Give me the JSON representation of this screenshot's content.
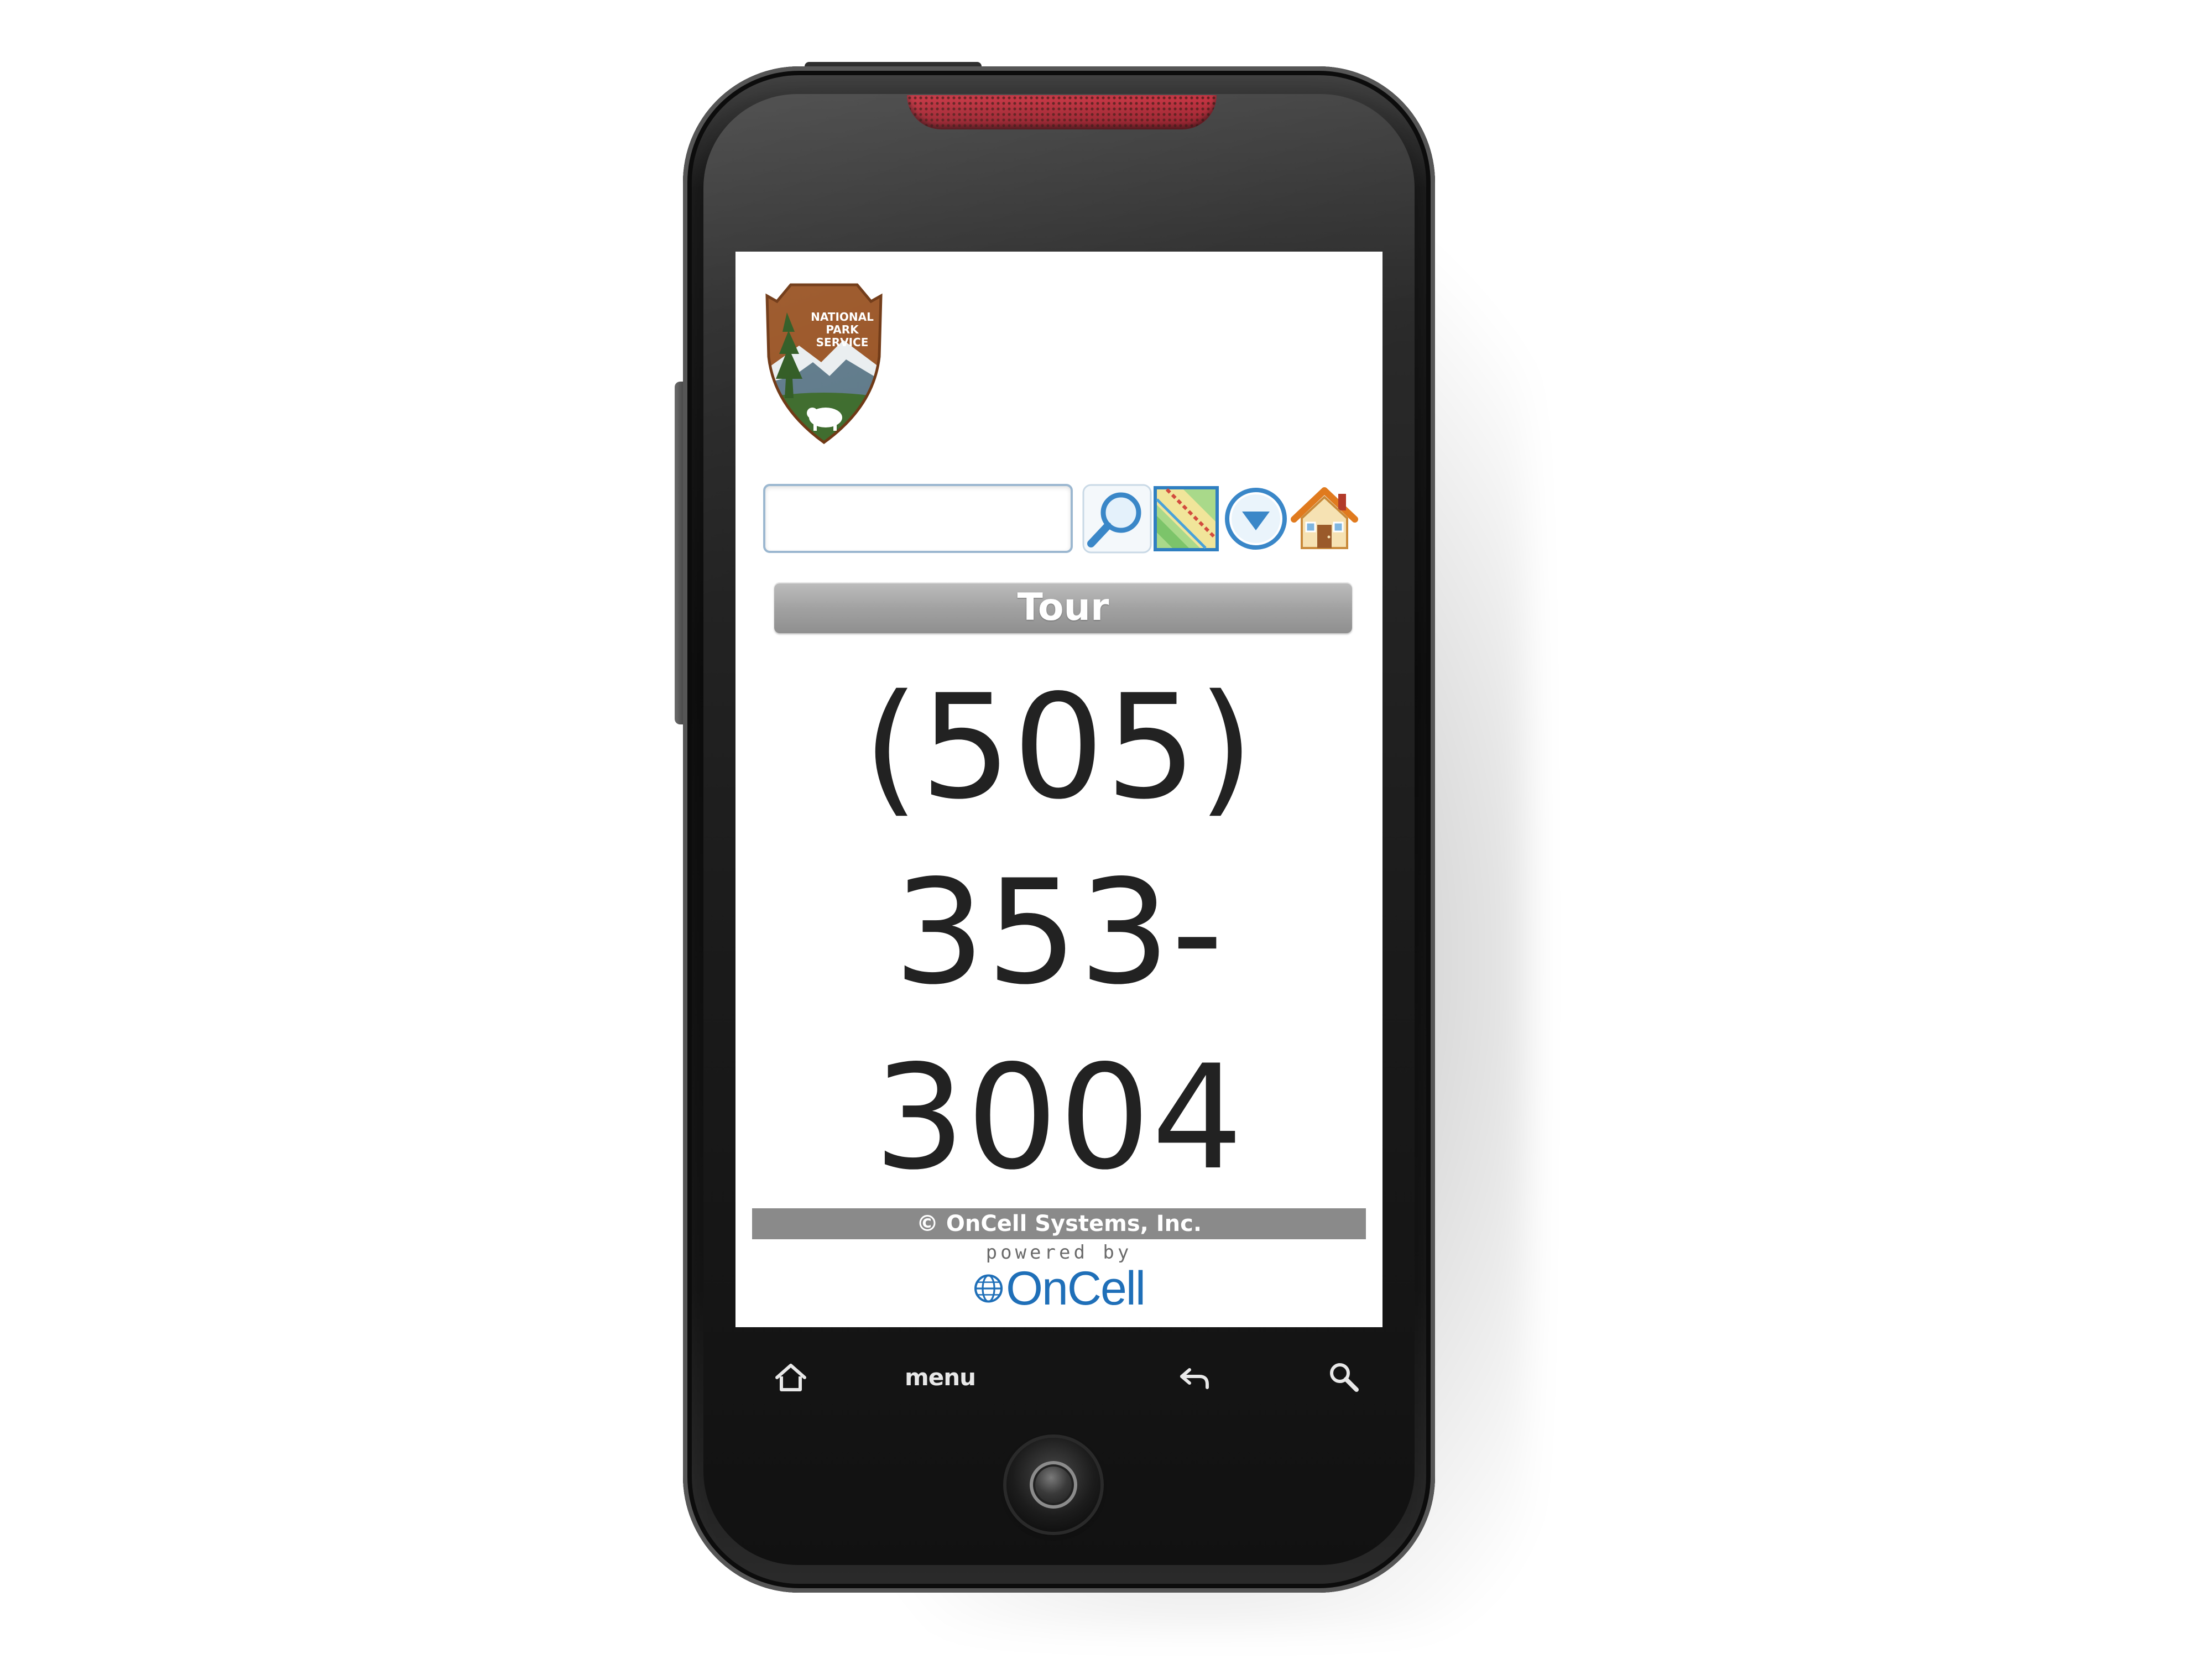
{
  "app": {
    "logo_text_line1": "NATIONAL",
    "logo_text_line2": "PARK",
    "logo_text_line3": "SERVICE"
  },
  "toolbar": {
    "search_value": "",
    "search_placeholder": "",
    "icons": [
      "search-icon",
      "map-icon",
      "dropdown-icon",
      "home-icon"
    ]
  },
  "section": {
    "title": "Tour"
  },
  "content": {
    "phone_line1": "(505)",
    "phone_line2": "353-",
    "phone_line3": "3004"
  },
  "footer": {
    "copyright": "© OnCell Systems, Inc.",
    "powered_by": "powered by",
    "brand": "OnCell"
  },
  "hardware_keys": {
    "menu_label": "menu",
    "icons": [
      "home-key-icon",
      "back-key-icon",
      "search-key-icon"
    ]
  },
  "colors": {
    "brand_blue": "#1f6fb8",
    "tour_bar": "#a2a2a2",
    "footer_bar": "#8a8a8a",
    "speaker_red": "#c62b3a",
    "nps_brown": "#8b4a1e",
    "nps_green": "#3d6b2c"
  }
}
